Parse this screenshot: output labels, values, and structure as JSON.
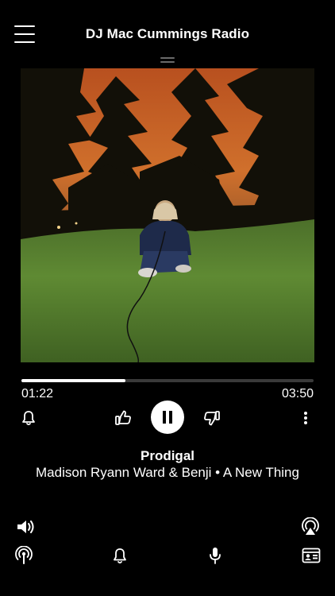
{
  "header": {
    "title": "DJ Mac Cummings Radio",
    "menu_icon": "hamburger-menu-icon"
  },
  "artwork": {
    "description_icon": "album-artwork"
  },
  "playback": {
    "elapsed": "01:22",
    "total": "03:50",
    "progress": 0.355
  },
  "controls": {
    "bell_icon": "bell-icon",
    "thumbs_up_icon": "thumbs-up-icon",
    "pause_icon": "pause-icon",
    "thumbs_down_icon": "thumbs-down-icon",
    "more_icon": "more-vertical-icon"
  },
  "track": {
    "title": "Prodigal",
    "artist_album": "Madison Ryann Ward & Benji • A New Thing"
  },
  "bottom_bar": {
    "volume_icon": "volume-icon",
    "airplay_icon": "airplay-icon",
    "podcast_icon": "podcast-icon",
    "alerts_icon": "bell-icon",
    "mic_icon": "microphone-icon",
    "profile_card_icon": "contact-card-icon"
  },
  "colors": {
    "background": "#000000",
    "text": "#ffffff",
    "track": "#3a3a3a"
  }
}
